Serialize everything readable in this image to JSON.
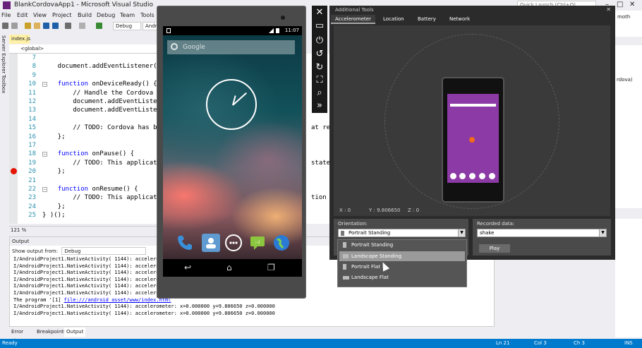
{
  "vs": {
    "title": "BlankCordovaApp1 - Microsoft Visual Studio",
    "quick_launch": "Quick Launch (Ctrl+Q)",
    "menu": [
      "File",
      "Edit",
      "View",
      "Project",
      "Build",
      "Debug",
      "Team",
      "Tools"
    ],
    "config": "Debug",
    "platform": "Andr",
    "side_tabs": [
      "Server Explorer",
      "Toolbox"
    ],
    "doc_tab": "index.js",
    "nav_scope": "<global>",
    "zoom": "121 %",
    "right_fragments": [
      "moth",
      "rdova)"
    ],
    "status": {
      "left": "Ready",
      "ln": "Ln 21",
      "col": "Col 3",
      "ch": "Ch 3",
      "mode": "INS"
    }
  },
  "editor": {
    "lines": [
      {
        "n": "7",
        "code": ""
      },
      {
        "n": "8",
        "code": "    document.addEventListener("
      },
      {
        "n": "9",
        "code": ""
      },
      {
        "n": "10",
        "code": "    function onDeviceReady() {"
      },
      {
        "n": "11",
        "code": "        // Handle the Cordova"
      },
      {
        "n": "12",
        "code": "        document.addEventListe"
      },
      {
        "n": "13",
        "code": "        document.addEventListe"
      },
      {
        "n": "14",
        "code": ""
      },
      {
        "n": "15",
        "code": "        // TODO: Cordova has b"
      },
      {
        "n": "16",
        "code": "    };"
      },
      {
        "n": "17",
        "code": ""
      },
      {
        "n": "18",
        "code": "    function onPause() {"
      },
      {
        "n": "19",
        "code": "        // TODO: This applicat"
      },
      {
        "n": "20",
        "code": "    };"
      },
      {
        "n": "21",
        "code": ""
      },
      {
        "n": "22",
        "code": "    function onResume() {"
      },
      {
        "n": "23",
        "code": "        // TODO: This applicat"
      },
      {
        "n": "24",
        "code": "    };"
      },
      {
        "n": "25",
        "code": "} )();"
      }
    ],
    "right_fragments": [
      {
        "line": 15,
        "text": "at req"
      },
      {
        "line": 19,
        "text": "state ("
      },
      {
        "line": 23,
        "text": "tion s"
      }
    ]
  },
  "output": {
    "title": "Output",
    "source_label": "Show output from:",
    "source_value": "Debug",
    "lines": [
      "I/AndroidProject1.NativeActivity( 1144): acceleromet",
      "I/AndroidProject1.NativeActivity( 1144): acceleromet",
      "I/AndroidProject1.NativeActivity( 1144): acceleromet",
      "I/AndroidProject1.NativeActivity( 1144): acceleromet",
      "I/AndroidProject1.NativeActivity( 1144): acceleromet",
      "I/AndroidProject1.NativeActivity( 1144): acceleromet"
    ],
    "program_line_prefix": "The program '[1] ",
    "program_line_link": "file:///android_asset/www/index.html",
    "last_lines": [
      "I/AndroidProject1.NativeActivity( 1144): accelerometer: x=0.000000 y=9.806650 z=0.000000",
      "I/AndroidProject1.NativeActivity( 1144): accelerometer: x=0.000000 y=9.806650 z=0.000000"
    ],
    "tabs": [
      "Error List",
      "Breakpoints",
      "Output"
    ]
  },
  "emulator": {
    "time": "11:07",
    "search_placeholder": "Google",
    "tools": [
      "close-icon",
      "minimize-icon",
      "power-icon",
      "rotate-left-icon",
      "rotate-right-icon",
      "fit-screen-icon",
      "zoom-icon",
      "more-tools-icon"
    ]
  },
  "additional_tools": {
    "title": "Additional Tools",
    "tabs": [
      "Accelerometer",
      "Location",
      "Battery",
      "Network"
    ],
    "readout": {
      "x": "X : 0",
      "y": "Y : 9.806650",
      "z": "Z : 0"
    },
    "orientation_label": "Orientation:",
    "orientation_value": "Portrait Standing",
    "orientation_options": [
      "Portrait Standing",
      "Landscape Standing",
      "Portrait Flat",
      "Landscape Flat"
    ],
    "recorded_label": "Recorded data:",
    "recorded_value": "shake",
    "play_label": "Play"
  }
}
